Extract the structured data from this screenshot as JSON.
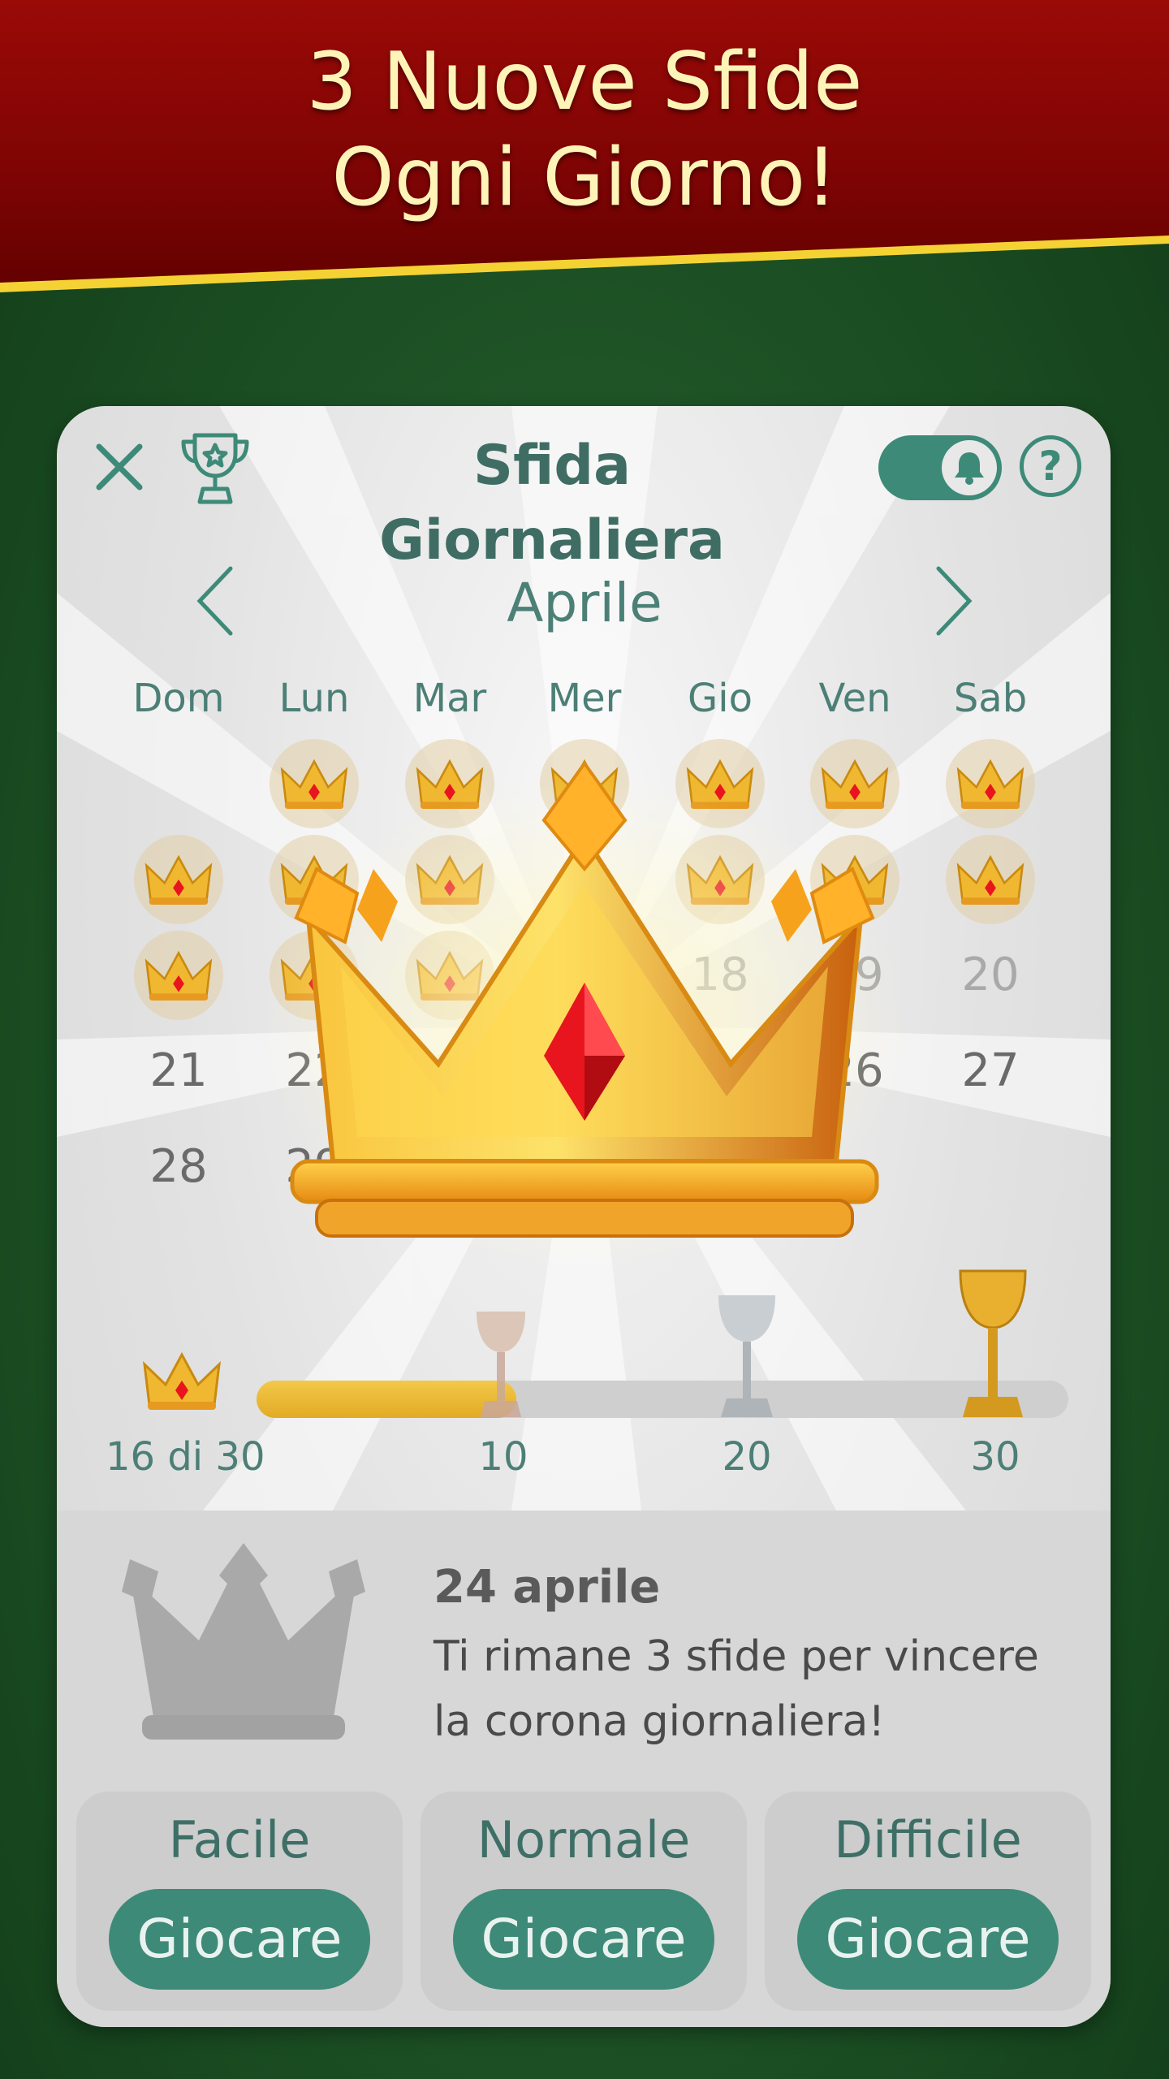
{
  "banner": {
    "line1": "3 Nuove Sfide",
    "line2": "Ogni Giorno!"
  },
  "header": {
    "title": "Sfida Giornaliera",
    "help": "?",
    "notifications_enabled": true
  },
  "calendar": {
    "month": "Aprile",
    "weekdays": [
      "Dom",
      "Lun",
      "Mar",
      "Mer",
      "Gio",
      "Ven",
      "Sab"
    ],
    "rows": [
      [
        "",
        "crown",
        "crown",
        "crown",
        "crown",
        "crown",
        "crown"
      ],
      [
        "crown",
        "crown",
        "crown",
        "",
        "crown",
        "crown",
        "crown"
      ],
      [
        "crown",
        "crown",
        "crown",
        "",
        "18",
        "19",
        "20"
      ],
      [
        "21",
        "22",
        "",
        "",
        "",
        "26",
        "27"
      ],
      [
        "28",
        "29",
        "",
        "",
        "",
        "",
        ""
      ]
    ]
  },
  "progress": {
    "label": "16 di 30",
    "current": 16,
    "total": 30,
    "milestones": [
      "10",
      "20",
      "30"
    ]
  },
  "info": {
    "date": "24 aprile",
    "message": "Ti rimane 3 sfide per vincere la corona giornaliera!"
  },
  "difficulties": [
    {
      "label": "Facile",
      "button": "Giocare"
    },
    {
      "label": "Normale",
      "button": "Giocare"
    },
    {
      "label": "Difficile",
      "button": "Giocare"
    }
  ],
  "colors": {
    "accent": "#3d8a78",
    "banner_red": "#8b0606",
    "banner_stripe": "#f5d233",
    "felt_green": "#1f5527",
    "gold": "#e2ab24"
  }
}
